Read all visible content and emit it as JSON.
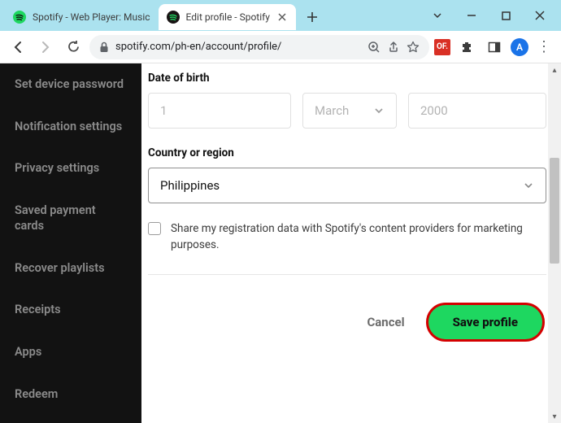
{
  "window": {
    "tabs": [
      {
        "title": "Spotify - Web Player: Music",
        "active": false,
        "favicon": "spotify"
      },
      {
        "title": "Edit profile - Spotify",
        "active": true,
        "favicon": "spotify-dark"
      }
    ],
    "controls": {
      "minimize": "–",
      "maximize": "▢",
      "close": "✕"
    }
  },
  "toolbar": {
    "url": "spotify.com/ph-en/account/profile/",
    "ext_badge": "OF.",
    "avatar_letter": "A"
  },
  "sidebar": {
    "items": [
      "Set device password",
      "Notification settings",
      "Privacy settings",
      "Saved payment cards",
      "Recover playlists",
      "Receipts",
      "Apps",
      "Redeem"
    ]
  },
  "form": {
    "dob_label": "Date of birth",
    "day_placeholder": "1",
    "month_placeholder": "March",
    "year_placeholder": "2000",
    "country_label": "Country or region",
    "country_value": "Philippines",
    "share_text": "Share my registration data with Spotify's content providers for marketing purposes.",
    "cancel_label": "Cancel",
    "save_label": "Save profile"
  }
}
